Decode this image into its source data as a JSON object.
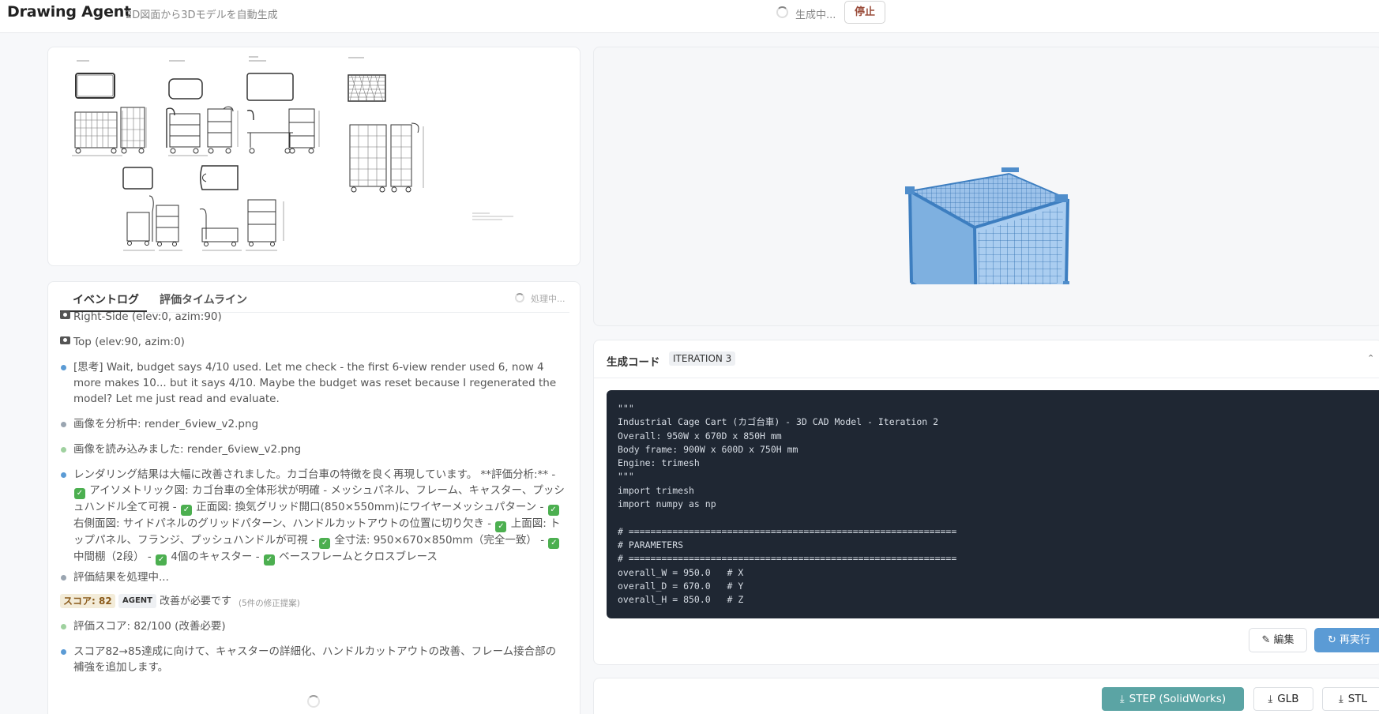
{
  "header": {
    "app_title": "Drawing Agent",
    "subtitle": "2D図面から3Dモデルを自動生成",
    "status": "生成中...",
    "stop_label": "停止"
  },
  "events_panel": {
    "tabs": [
      "イベントログ",
      "評価タイムライン"
    ],
    "active_tab": "イベントログ",
    "processing_label": "処理中...",
    "items": [
      {
        "type": "camera",
        "text": "Right-Side (elev:0, azim:90)"
      },
      {
        "type": "camera",
        "text": "Top (elev:90, azim:0)"
      },
      {
        "type": "blue",
        "text": "[思考] Wait, budget says 4/10 used. Let me check - the first 6-view render used 6, now 4 more makes 10... but it says 4/10. Maybe the budget was reset because I regenerated the model? Let me just read and evaluate."
      },
      {
        "type": "gray",
        "text": "画像を分析中: render_6view_v2.png"
      },
      {
        "type": "green",
        "text": "画像を読み込みました: render_6view_v2.png"
      },
      {
        "type": "blue",
        "segments": [
          "レンダリング結果は大幅に改善されました。カゴ台車の特徴を良く再現しています。 **評価分析:** - ",
          " アイソメトリック図: カゴ台車の全体形状が明確 - メッシュパネル、フレーム、キャスター、プッシュハンドル全て可視 - ",
          " 正面図: 換気グリッド開口(850×550mm)にワイヤーメッシュパターン - ",
          " 右側面図: サイドパネルのグリッドパターン、ハンドルカットアウトの位置に切り欠き - ",
          " 上面図: トップパネル、フランジ、プッシュハンドルが可視 - ",
          " 全寸法: 950×670×850mm（完全一致） - ",
          " 中間棚（2段） - ",
          " 4個のキャスター - ",
          " ベースフレームとクロスブレース"
        ]
      },
      {
        "type": "gray",
        "text": "評価結果を処理中..."
      },
      {
        "type": "score",
        "score_label": "スコア: 82",
        "agent_label": "AGENT",
        "result": "改善が必要です",
        "sub": "(5件の修正提案)"
      },
      {
        "type": "green",
        "text": "評価スコア: 82/100 (改善必要)"
      },
      {
        "type": "blue",
        "text": "スコア82→85達成に向けて、キャスターの詳細化、ハンドルカットアウトの改善、フレーム接合部の補強を追加します。"
      }
    ]
  },
  "code_panel": {
    "title": "生成コード",
    "iteration": "ITERATION 3",
    "code_lines": [
      "\"\"\"",
      "Industrial Cage Cart (カゴ台車) - 3D CAD Model - Iteration 2",
      "Overall: 950W x 670D x 850H mm",
      "Body frame: 900W x 600D x 750H mm",
      "Engine: trimesh",
      "\"\"\"",
      "import trimesh",
      "import numpy as np",
      "",
      "# ============================================================",
      "# PARAMETERS",
      "# ============================================================",
      "overall_W = 950.0   # X",
      "overall_D = 670.0   # Y",
      "overall_H = 850.0   # Z"
    ],
    "edit_label": "編集",
    "rerun_label": "再実行"
  },
  "downloads": {
    "step_label": "STEP (SolidWorks)",
    "glb_label": "GLB",
    "stl_label": "STL"
  },
  "colors": {
    "accent_blue": "#5b9bd5",
    "step_teal": "#5ba4a4",
    "code_bg": "#1f2733",
    "check_green": "#4caf50"
  },
  "icons": [
    "camera-icon",
    "spinner-icon",
    "edit-icon",
    "refresh-icon",
    "download-icon",
    "chevron-up-icon",
    "check-icon"
  ]
}
